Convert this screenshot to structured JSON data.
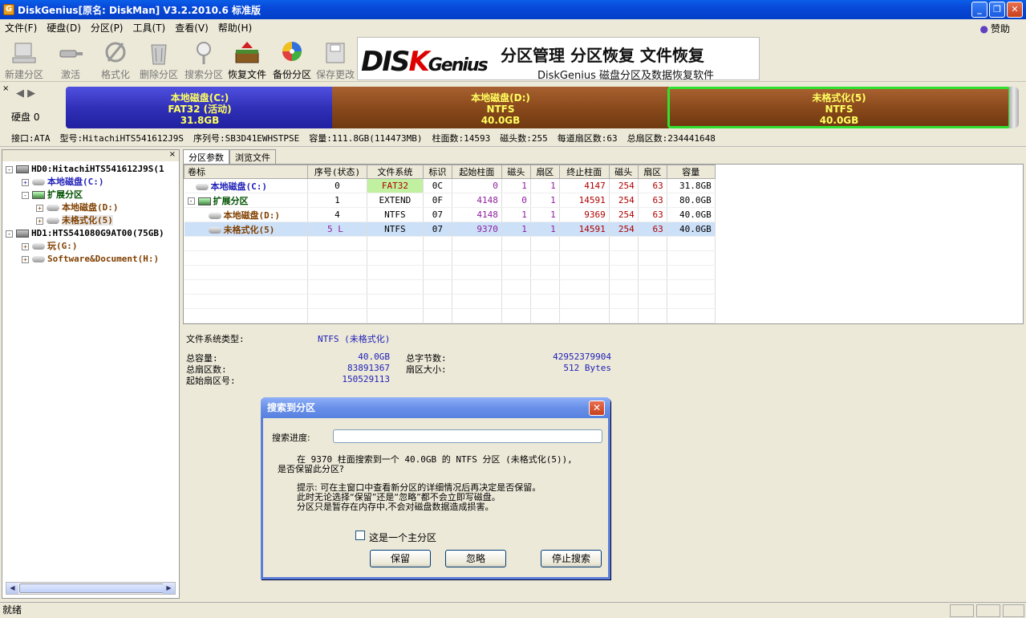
{
  "window": {
    "title": "DiskGenius[原名: DiskMan] V3.2.2010.6 标准版",
    "icon": "disk-app-icon",
    "minimize": "_",
    "maximize": "❐",
    "close": "✕"
  },
  "menu": [
    {
      "label": "文件(F)"
    },
    {
      "label": "硬盘(D)"
    },
    {
      "label": "分区(P)"
    },
    {
      "label": "工具(T)"
    },
    {
      "label": "查看(V)"
    },
    {
      "label": "帮助(H)"
    }
  ],
  "donate": "赞助",
  "toolbar": [
    {
      "label": "新建分区",
      "icon": "new-partition-icon",
      "enabled": false
    },
    {
      "label": "激活",
      "icon": "activate-icon",
      "enabled": false
    },
    {
      "label": "格式化",
      "icon": "format-icon",
      "enabled": false
    },
    {
      "label": "删除分区",
      "icon": "delete-partition-icon",
      "enabled": false
    },
    {
      "label": "搜索分区",
      "icon": "search-partition-icon",
      "enabled": false
    },
    {
      "label": "恢复文件",
      "icon": "recover-files-icon",
      "enabled": true
    },
    {
      "label": "备份分区",
      "icon": "backup-partition-icon",
      "enabled": true
    },
    {
      "label": "保存更改",
      "icon": "save-changes-icon",
      "enabled": false
    }
  ],
  "banner": {
    "logo_a": "DIS",
    "logo_k": "K",
    "logo_b": "Genius",
    "title": "分区管理 分区恢复 文件恢复",
    "subtitle": "DiskGenius 磁盘分区及数据恢复软件"
  },
  "diskmap": {
    "disk_label": "硬盘 0",
    "nav": "◀ ▶",
    "partitions": [
      {
        "name": "本地磁盘(C:)",
        "fs": "FAT32 (活动)",
        "size": "31.8GB"
      },
      {
        "name": "本地磁盘(D:)",
        "fs": "NTFS",
        "size": "40.0GB"
      },
      {
        "name": "未格式化(5)",
        "fs": "NTFS",
        "size": "40.0GB"
      }
    ]
  },
  "diskinfo": [
    "接口:ATA",
    "型号:HitachiHTS541612J9S",
    "序列号:SB3D41EWHSTPSE",
    "容量:111.8GB(114473MB)",
    "柱面数:14593",
    "磁头数:255",
    "每道扇区数:63",
    "总扇区数:234441648"
  ],
  "tree": [
    {
      "label": "HD0:HitachiHTS541612J9S(1",
      "type": "disk",
      "pm": "-"
    },
    {
      "label": "本地磁盘(C:)",
      "type": "part",
      "pm": "+",
      "color": "blue"
    },
    {
      "label": "扩展分区",
      "type": "ext",
      "pm": "-",
      "color": "green"
    },
    {
      "label": "本地磁盘(D:)",
      "type": "part",
      "pm": "+",
      "color": "brown"
    },
    {
      "label": "未格式化(5)",
      "type": "part",
      "pm": "+",
      "color": "brown"
    },
    {
      "label": "HD1:HTS541080G9AT00(75GB)",
      "type": "disk",
      "pm": "-"
    },
    {
      "label": "玩(G:)",
      "type": "part",
      "pm": "+",
      "color": "brown"
    },
    {
      "label": "Software&Document(H:)",
      "type": "part",
      "pm": "+",
      "color": "brown"
    }
  ],
  "tabs": [
    "分区参数",
    "浏览文件"
  ],
  "columns": [
    "卷标",
    "序号(状态)",
    "文件系统",
    "标识",
    "起始柱面",
    "磁头",
    "扇区",
    "终止柱面",
    "磁头",
    "扇区",
    "容量"
  ],
  "rows": [
    {
      "label": "本地磁盘(C:)",
      "cls": "blue",
      "indent": 14,
      "cells": [
        "0",
        "FAT32",
        "0C",
        "0",
        "1",
        "1",
        "4147",
        "254",
        "63",
        "31.8GB"
      ]
    },
    {
      "label": "扩展分区",
      "cls": "green",
      "indent": 4,
      "cells": [
        "1",
        "EXTEND",
        "0F",
        "4148",
        "0",
        "1",
        "14591",
        "254",
        "63",
        "80.0GB"
      ]
    },
    {
      "label": "本地磁盘(D:)",
      "cls": "brown",
      "indent": 30,
      "cells": [
        "4",
        "NTFS",
        "07",
        "4148",
        "1",
        "1",
        "9369",
        "254",
        "63",
        "40.0GB"
      ]
    },
    {
      "label": "未格式化(5)",
      "cls": "brown",
      "indent": 30,
      "cells": [
        "5 L",
        "NTFS",
        "07",
        "9370",
        "1",
        "1",
        "14591",
        "254",
        "63",
        "40.0GB"
      ],
      "selected": true
    }
  ],
  "details": {
    "fs_type_label": "文件系统类型:",
    "fs_type_value": "NTFS (未格式化)",
    "total_cap_label": "总容量:",
    "total_cap_value": "40.0GB",
    "total_sec_label": "总扇区数:",
    "total_sec_value": "83891367",
    "start_sec_label": "起始扇区号:",
    "start_sec_value": "150529113",
    "total_bytes_label": "总字节数:",
    "total_bytes_value": "42952379904",
    "sec_size_label": "扇区大小:",
    "sec_size_value": "512 Bytes"
  },
  "dialog": {
    "title": "搜索到分区",
    "progress_label": "搜索进度:",
    "msg1": "在 9370 柱面搜索到一个 40.0GB 的 NTFS 分区 (未格式化(5)),",
    "msg2": "是否保留此分区?",
    "hint1": "提示: 可在主窗口中查看新分区的详细情况后再决定是否保留。",
    "hint2": "此时无论选择“保留”还是“忽略”都不会立即写磁盘。",
    "hint3": "分区只是暂存在内存中,不会对磁盘数据造成损害。",
    "checkbox": "这是一个主分区",
    "keep": "保留",
    "ignore": "忽略",
    "stop": "停止搜索"
  },
  "status": "就绪"
}
